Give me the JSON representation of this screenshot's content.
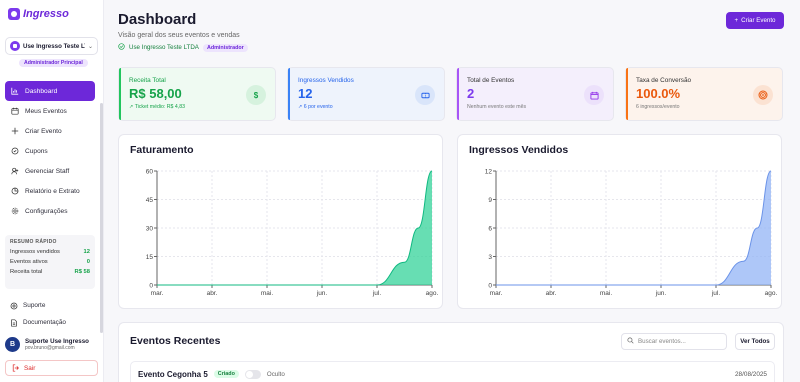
{
  "app": {
    "logo_text": "Ingresso"
  },
  "sidebar": {
    "org_name": "Use Ingresso Teste LTDA",
    "role": "Administrador Principal",
    "nav": [
      {
        "label": "Dashboard",
        "icon": "dashboard-icon",
        "active": true
      },
      {
        "label": "Meus Eventos",
        "icon": "calendar-icon"
      },
      {
        "label": "Criar Evento",
        "icon": "plus-icon"
      },
      {
        "label": "Cupons",
        "icon": "coupon-icon"
      },
      {
        "label": "Gerenciar Staff",
        "icon": "staff-icon"
      },
      {
        "label": "Relatório e Extrato",
        "icon": "report-icon"
      },
      {
        "label": "Configurações",
        "icon": "gear-icon"
      }
    ],
    "quick": {
      "title": "RESUMO RÁPIDO",
      "rows": [
        {
          "label": "Ingressos vendidos",
          "value": "12"
        },
        {
          "label": "Eventos ativos",
          "value": "0"
        },
        {
          "label": "Receita total",
          "value": "R$ 58"
        }
      ]
    },
    "footer_links": [
      {
        "label": "Suporte",
        "icon": "help-icon"
      },
      {
        "label": "Documentação",
        "icon": "doc-icon"
      }
    ],
    "user": {
      "initial": "B",
      "name": "Suporte Use Ingresso",
      "email": "pov.bruno@gmail.com"
    },
    "logout_label": "Sair"
  },
  "header": {
    "title": "Dashboard",
    "subtitle": "Visão geral dos seus eventos e vendas",
    "company": "Use Ingresso Teste LTDA",
    "badge": "Administrador",
    "create_button": "Criar Evento"
  },
  "stats": [
    {
      "label": "Receita Total",
      "value": "R$ 58,00",
      "note": "Ticket médio: R$ 4,83",
      "icon": "$"
    },
    {
      "label": "Ingressos Vendidos",
      "value": "12",
      "note": "6 por evento",
      "icon": "ticket"
    },
    {
      "label": "Total de Eventos",
      "value": "2",
      "note": "Nenhum evento este mês",
      "icon": "calendar"
    },
    {
      "label": "Taxa de Conversão",
      "value": "100.0%",
      "note": "6 ingressos/evento",
      "icon": "target"
    }
  ],
  "colors": {
    "accent": "#6d28d9",
    "revenue": "#34d399",
    "tickets": "#93b4f5"
  },
  "chart_data": [
    {
      "type": "area",
      "title": "Faturamento",
      "categories": [
        "mar.",
        "abr.",
        "mai.",
        "jun.",
        "jul.",
        "ago."
      ],
      "x": [
        0,
        1,
        2,
        3,
        4,
        4.5,
        4.75,
        5
      ],
      "values": [
        0,
        0,
        0,
        0,
        0,
        12,
        30,
        60
      ],
      "yticks": [
        0,
        15,
        30,
        45,
        60
      ],
      "ylim": [
        0,
        60
      ]
    },
    {
      "type": "area",
      "title": "Ingressos Vendidos",
      "categories": [
        "mar.",
        "abr.",
        "mai.",
        "jun.",
        "jul.",
        "ago."
      ],
      "x": [
        0,
        1,
        2,
        3,
        4,
        4.5,
        4.75,
        5
      ],
      "values": [
        0,
        0,
        0,
        0,
        0,
        2.5,
        6,
        12
      ],
      "yticks": [
        0,
        3,
        6,
        9,
        12
      ],
      "ylim": [
        0,
        12
      ]
    }
  ],
  "events": {
    "title": "Eventos Recentes",
    "search_placeholder": "Buscar eventos...",
    "view_all": "Ver Todos",
    "items": [
      {
        "name": "Evento Cegonha 5",
        "status": "Criado",
        "visibility": "Oculto",
        "date": "28/08/2025"
      }
    ]
  }
}
